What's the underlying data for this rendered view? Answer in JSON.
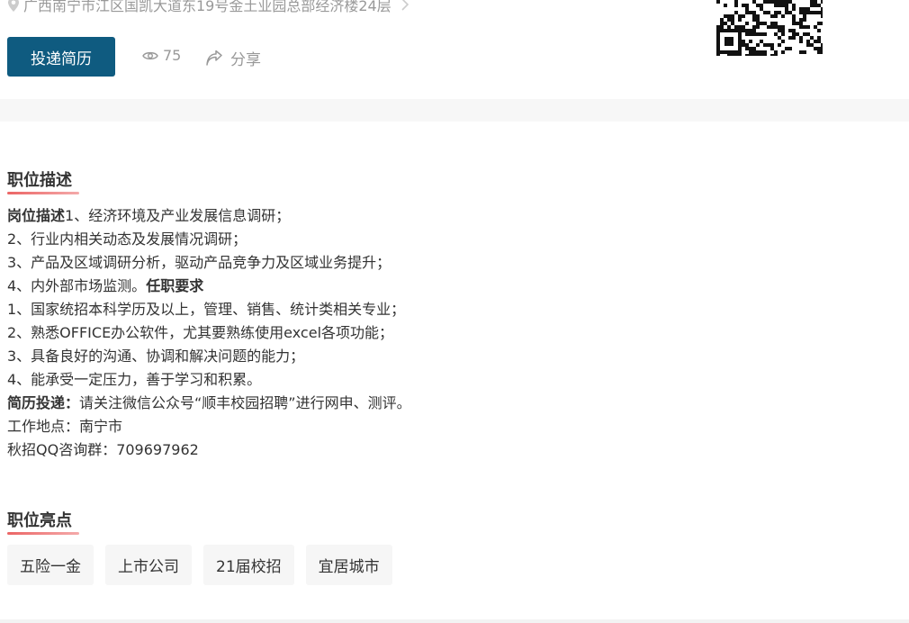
{
  "location": {
    "address": "广西南宁市江区国凯大道东19号金土业园总部经济楼24层"
  },
  "actions": {
    "apply_label": "投递简历",
    "views_count": "75",
    "share_label": "分享"
  },
  "job_description": {
    "heading": "职位描述",
    "lines": [
      {
        "bold": "岗位描述",
        "text": "1、经济环境及产业发展信息调研；"
      },
      {
        "bold": "",
        "text": "2、行业内相关动态及发展情况调研；"
      },
      {
        "bold": "",
        "text": "3、产品及区域调研分析，驱动产品竞争力及区域业务提升；"
      },
      {
        "bold": "任职要求",
        "text": "4、内外部市场监测。"
      },
      {
        "bold": "",
        "text": "1、国家统招本科学历及以上，管理、销售、统计类相关专业；"
      },
      {
        "bold": "",
        "text": "2、熟悉OFFICE办公软件，尤其要熟练使用excel各项功能；"
      },
      {
        "bold": "",
        "text": "3、具备良好的沟通、协调和解决问题的能力；"
      },
      {
        "bold": "",
        "text": "4、能承受一定压力，善于学习和积累。"
      },
      {
        "bold": "简历投递：",
        "text": "请关注微信公众号“顺丰校园招聘”进行网申、测评。"
      },
      {
        "bold": "",
        "text": "工作地点：南宁市"
      },
      {
        "bold": "",
        "text": "秋招QQ咨询群：709697962"
      }
    ]
  },
  "highlights": {
    "heading": "职位亮点",
    "tags": [
      "五险一金",
      "上市公司",
      "21届校招",
      "宜居城市"
    ]
  },
  "colors": {
    "primary_button": "#0f5b80",
    "heading_underline": "#e84a4a",
    "muted_text": "#999999"
  }
}
